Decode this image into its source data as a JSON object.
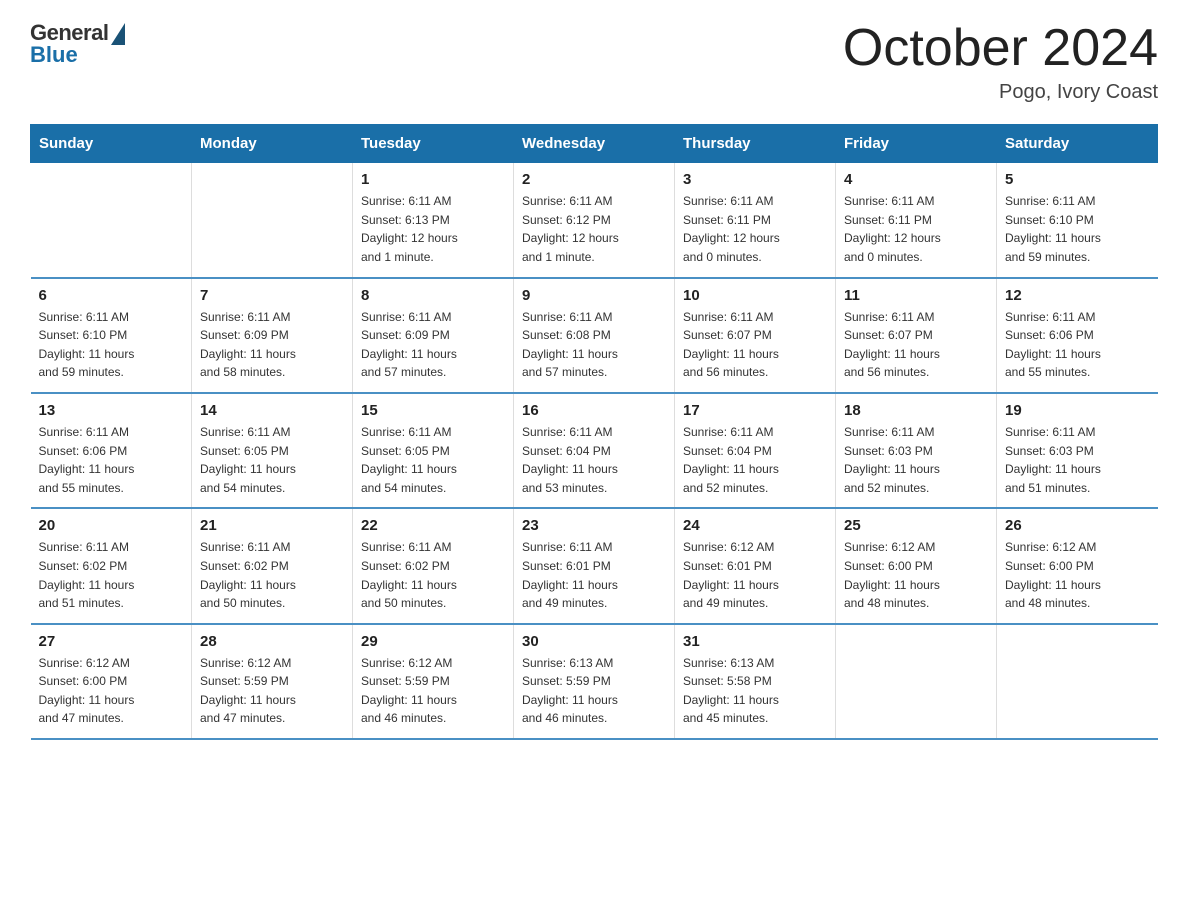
{
  "header": {
    "logo_general": "General",
    "logo_blue": "Blue",
    "month": "October 2024",
    "location": "Pogo, Ivory Coast"
  },
  "days_of_week": [
    "Sunday",
    "Monday",
    "Tuesday",
    "Wednesday",
    "Thursday",
    "Friday",
    "Saturday"
  ],
  "weeks": [
    [
      {
        "day": "",
        "info": ""
      },
      {
        "day": "",
        "info": ""
      },
      {
        "day": "1",
        "info": "Sunrise: 6:11 AM\nSunset: 6:13 PM\nDaylight: 12 hours\nand 1 minute."
      },
      {
        "day": "2",
        "info": "Sunrise: 6:11 AM\nSunset: 6:12 PM\nDaylight: 12 hours\nand 1 minute."
      },
      {
        "day": "3",
        "info": "Sunrise: 6:11 AM\nSunset: 6:11 PM\nDaylight: 12 hours\nand 0 minutes."
      },
      {
        "day": "4",
        "info": "Sunrise: 6:11 AM\nSunset: 6:11 PM\nDaylight: 12 hours\nand 0 minutes."
      },
      {
        "day": "5",
        "info": "Sunrise: 6:11 AM\nSunset: 6:10 PM\nDaylight: 11 hours\nand 59 minutes."
      }
    ],
    [
      {
        "day": "6",
        "info": "Sunrise: 6:11 AM\nSunset: 6:10 PM\nDaylight: 11 hours\nand 59 minutes."
      },
      {
        "day": "7",
        "info": "Sunrise: 6:11 AM\nSunset: 6:09 PM\nDaylight: 11 hours\nand 58 minutes."
      },
      {
        "day": "8",
        "info": "Sunrise: 6:11 AM\nSunset: 6:09 PM\nDaylight: 11 hours\nand 57 minutes."
      },
      {
        "day": "9",
        "info": "Sunrise: 6:11 AM\nSunset: 6:08 PM\nDaylight: 11 hours\nand 57 minutes."
      },
      {
        "day": "10",
        "info": "Sunrise: 6:11 AM\nSunset: 6:07 PM\nDaylight: 11 hours\nand 56 minutes."
      },
      {
        "day": "11",
        "info": "Sunrise: 6:11 AM\nSunset: 6:07 PM\nDaylight: 11 hours\nand 56 minutes."
      },
      {
        "day": "12",
        "info": "Sunrise: 6:11 AM\nSunset: 6:06 PM\nDaylight: 11 hours\nand 55 minutes."
      }
    ],
    [
      {
        "day": "13",
        "info": "Sunrise: 6:11 AM\nSunset: 6:06 PM\nDaylight: 11 hours\nand 55 minutes."
      },
      {
        "day": "14",
        "info": "Sunrise: 6:11 AM\nSunset: 6:05 PM\nDaylight: 11 hours\nand 54 minutes."
      },
      {
        "day": "15",
        "info": "Sunrise: 6:11 AM\nSunset: 6:05 PM\nDaylight: 11 hours\nand 54 minutes."
      },
      {
        "day": "16",
        "info": "Sunrise: 6:11 AM\nSunset: 6:04 PM\nDaylight: 11 hours\nand 53 minutes."
      },
      {
        "day": "17",
        "info": "Sunrise: 6:11 AM\nSunset: 6:04 PM\nDaylight: 11 hours\nand 52 minutes."
      },
      {
        "day": "18",
        "info": "Sunrise: 6:11 AM\nSunset: 6:03 PM\nDaylight: 11 hours\nand 52 minutes."
      },
      {
        "day": "19",
        "info": "Sunrise: 6:11 AM\nSunset: 6:03 PM\nDaylight: 11 hours\nand 51 minutes."
      }
    ],
    [
      {
        "day": "20",
        "info": "Sunrise: 6:11 AM\nSunset: 6:02 PM\nDaylight: 11 hours\nand 51 minutes."
      },
      {
        "day": "21",
        "info": "Sunrise: 6:11 AM\nSunset: 6:02 PM\nDaylight: 11 hours\nand 50 minutes."
      },
      {
        "day": "22",
        "info": "Sunrise: 6:11 AM\nSunset: 6:02 PM\nDaylight: 11 hours\nand 50 minutes."
      },
      {
        "day": "23",
        "info": "Sunrise: 6:11 AM\nSunset: 6:01 PM\nDaylight: 11 hours\nand 49 minutes."
      },
      {
        "day": "24",
        "info": "Sunrise: 6:12 AM\nSunset: 6:01 PM\nDaylight: 11 hours\nand 49 minutes."
      },
      {
        "day": "25",
        "info": "Sunrise: 6:12 AM\nSunset: 6:00 PM\nDaylight: 11 hours\nand 48 minutes."
      },
      {
        "day": "26",
        "info": "Sunrise: 6:12 AM\nSunset: 6:00 PM\nDaylight: 11 hours\nand 48 minutes."
      }
    ],
    [
      {
        "day": "27",
        "info": "Sunrise: 6:12 AM\nSunset: 6:00 PM\nDaylight: 11 hours\nand 47 minutes."
      },
      {
        "day": "28",
        "info": "Sunrise: 6:12 AM\nSunset: 5:59 PM\nDaylight: 11 hours\nand 47 minutes."
      },
      {
        "day": "29",
        "info": "Sunrise: 6:12 AM\nSunset: 5:59 PM\nDaylight: 11 hours\nand 46 minutes."
      },
      {
        "day": "30",
        "info": "Sunrise: 6:13 AM\nSunset: 5:59 PM\nDaylight: 11 hours\nand 46 minutes."
      },
      {
        "day": "31",
        "info": "Sunrise: 6:13 AM\nSunset: 5:58 PM\nDaylight: 11 hours\nand 45 minutes."
      },
      {
        "day": "",
        "info": ""
      },
      {
        "day": "",
        "info": ""
      }
    ]
  ]
}
